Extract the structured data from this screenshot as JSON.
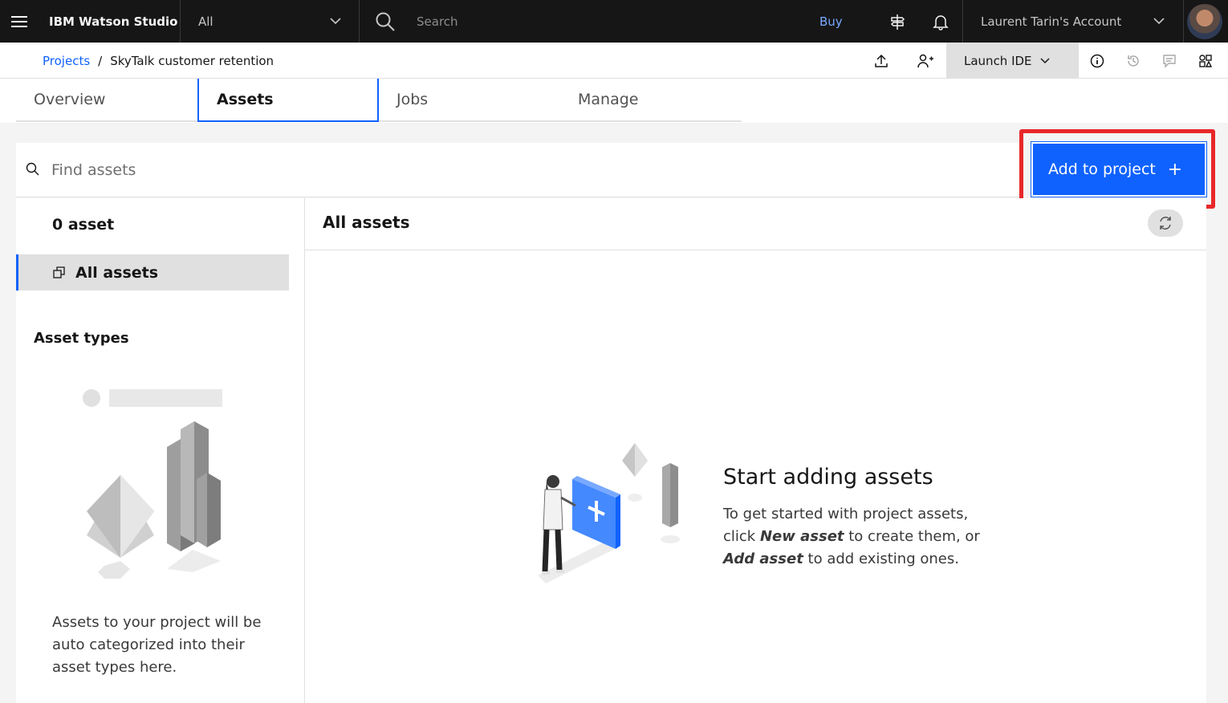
{
  "header": {
    "brand": "IBM Watson Studio",
    "scope_value": "All",
    "search_placeholder": "Search",
    "buy_label": "Buy",
    "account_label": "Laurent Tarin's Account"
  },
  "breadcrumb": {
    "projects_label": "Projects",
    "separator": "/",
    "current": "SkyTalk customer retention",
    "launch_label": "Launch IDE"
  },
  "tabs": [
    {
      "label": "Overview"
    },
    {
      "label": "Assets"
    },
    {
      "label": "Jobs"
    },
    {
      "label": "Manage"
    }
  ],
  "find": {
    "placeholder": "Find assets"
  },
  "add_button": {
    "label": "Add to project",
    "icon": "+"
  },
  "sidebar": {
    "count": "0 asset",
    "all_assets": "All assets",
    "types_heading": "Asset types",
    "types_text": "Assets to your project will be auto categorized into their asset types here."
  },
  "main": {
    "title": "All assets",
    "empty_title": "Start adding assets",
    "empty_line1": "To get started with project assets,",
    "empty_click": "click",
    "empty_new": "New asset",
    "empty_mid": "to create them, or",
    "empty_add": "Add asset",
    "empty_end": "to add existing ones."
  },
  "colors": {
    "brand_blue": "#0f62fe",
    "header_bg": "#161616",
    "highlight_red": "#e8282a"
  }
}
